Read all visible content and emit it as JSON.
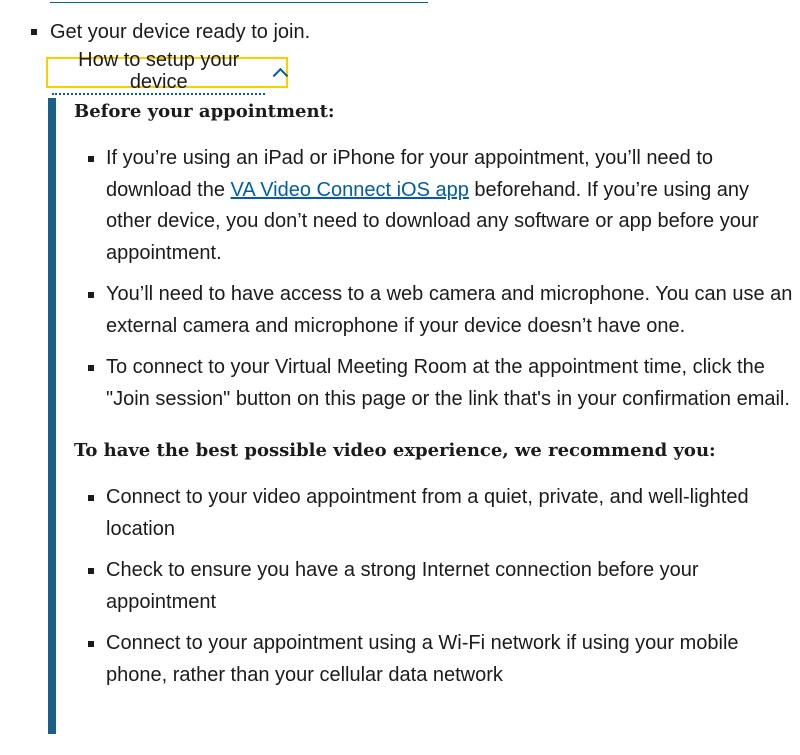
{
  "device_item": {
    "text": "Get your device ready to join.",
    "toggle_label": "How to setup your device"
  },
  "setup_details": {
    "before_heading": "Before your appointment:",
    "before_items": [
      {
        "pre": "If you’re using an iPad or iPhone for your appointment, you’ll need to download the ",
        "link": "VA Video Connect iOS app",
        "post": " beforehand. If you’re using any other device, you don’t need to download any software or app before your appointment."
      },
      {
        "text": "You’ll need to have access to a web camera and microphone. You can use an external camera and microphone if your device doesn’t have one."
      },
      {
        "text": "To connect to your Virtual Meeting Room at the appointment time, click the \"Join session\" button on this page or the link that's in your confirmation email."
      }
    ],
    "best_heading": "To have the best possible video experience, we recommend you:",
    "best_items": [
      {
        "text": "Connect to your video appointment from a quiet, private, and well-lighted location"
      },
      {
        "text": "Check to ensure you have a strong Internet connection before your appointment"
      },
      {
        "text": "Connect to your appointment using a Wi-Fi network if using your mobile phone, rather than your cellular data network"
      }
    ]
  },
  "icons": {
    "toggle": "chevron-up-icon",
    "bullet": "square-bullet-icon"
  },
  "colors": {
    "link": "#005ea2",
    "focus_outline": "#face00",
    "panel_border": "#1a5e8a",
    "text": "#1b1b1b"
  }
}
